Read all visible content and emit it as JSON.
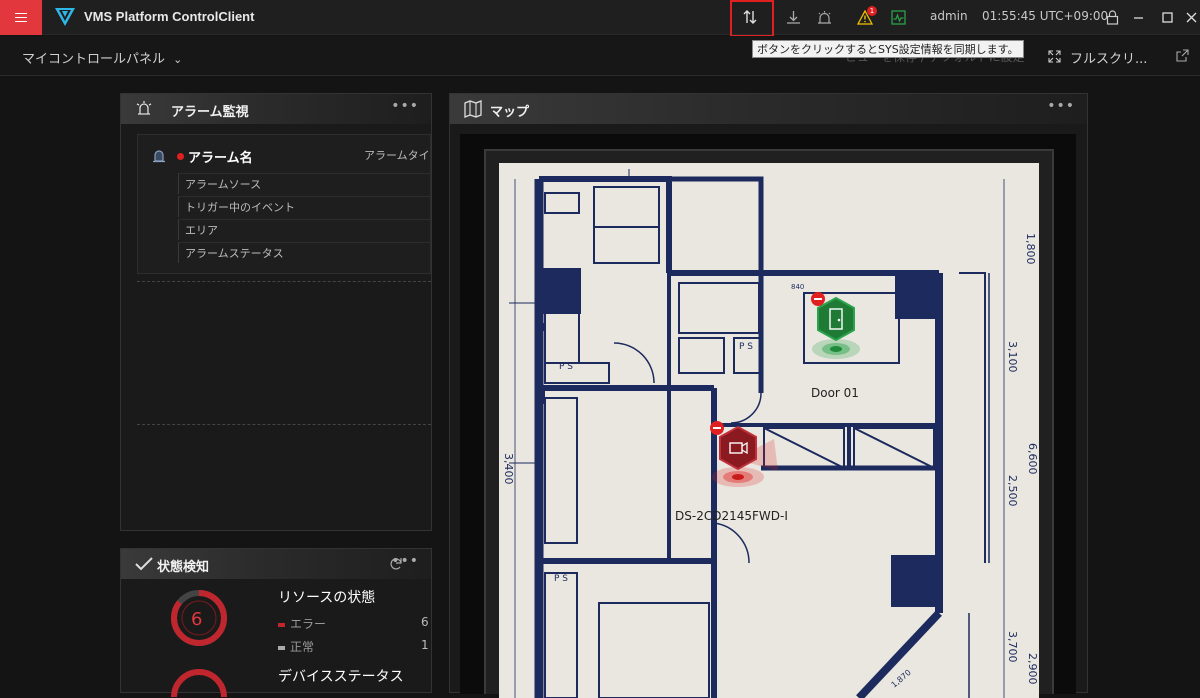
{
  "app": {
    "title": "VMS Platform ControlClient"
  },
  "topbar": {
    "user": "admin",
    "clock": "01:55:45 UTC+09:00",
    "alarm_count": "1",
    "tooltip": "ボタンをクリックするとSYS設定情報を同期します。"
  },
  "subbar": {
    "panel_selector": "マイコントロールパネル",
    "fullscreen": "フルスクリ...",
    "hidden_hint": "ビューを保存 / デフォルトに設定"
  },
  "alarm_card": {
    "title": "アラーム監視",
    "alarm_name_header": "アラーム名",
    "alarm_type_header": "アラームタイ",
    "rows": [
      "アラームソース",
      "トリガー中のイベント",
      "エリア",
      "アラームステータス"
    ]
  },
  "status_card": {
    "title": "状態検知",
    "resource_title": "リソースの状態",
    "error_label": "エラー",
    "error_value": "6",
    "normal_label": "正常",
    "normal_value": "1",
    "donut_value": "6",
    "device_title": "デバイスステータス"
  },
  "map_card": {
    "title": "マップ",
    "markers": [
      {
        "label": "Door 01",
        "state": "normal"
      },
      {
        "label": "DS-2CD2145FWD-I",
        "state": "alarm"
      }
    ],
    "plan_dimensions": [
      "1,800",
      "3,100",
      "6,600",
      "2,500",
      "3,700",
      "3,400",
      "2,900",
      "840",
      "1,870"
    ],
    "plan_room_marks": [
      "P S",
      "P S",
      "P S"
    ]
  },
  "colors": {
    "accent": "#e2373d",
    "ok": "#2aa34a",
    "alarm": "#c0303a",
    "panel_bg": "#1a1a1a"
  }
}
